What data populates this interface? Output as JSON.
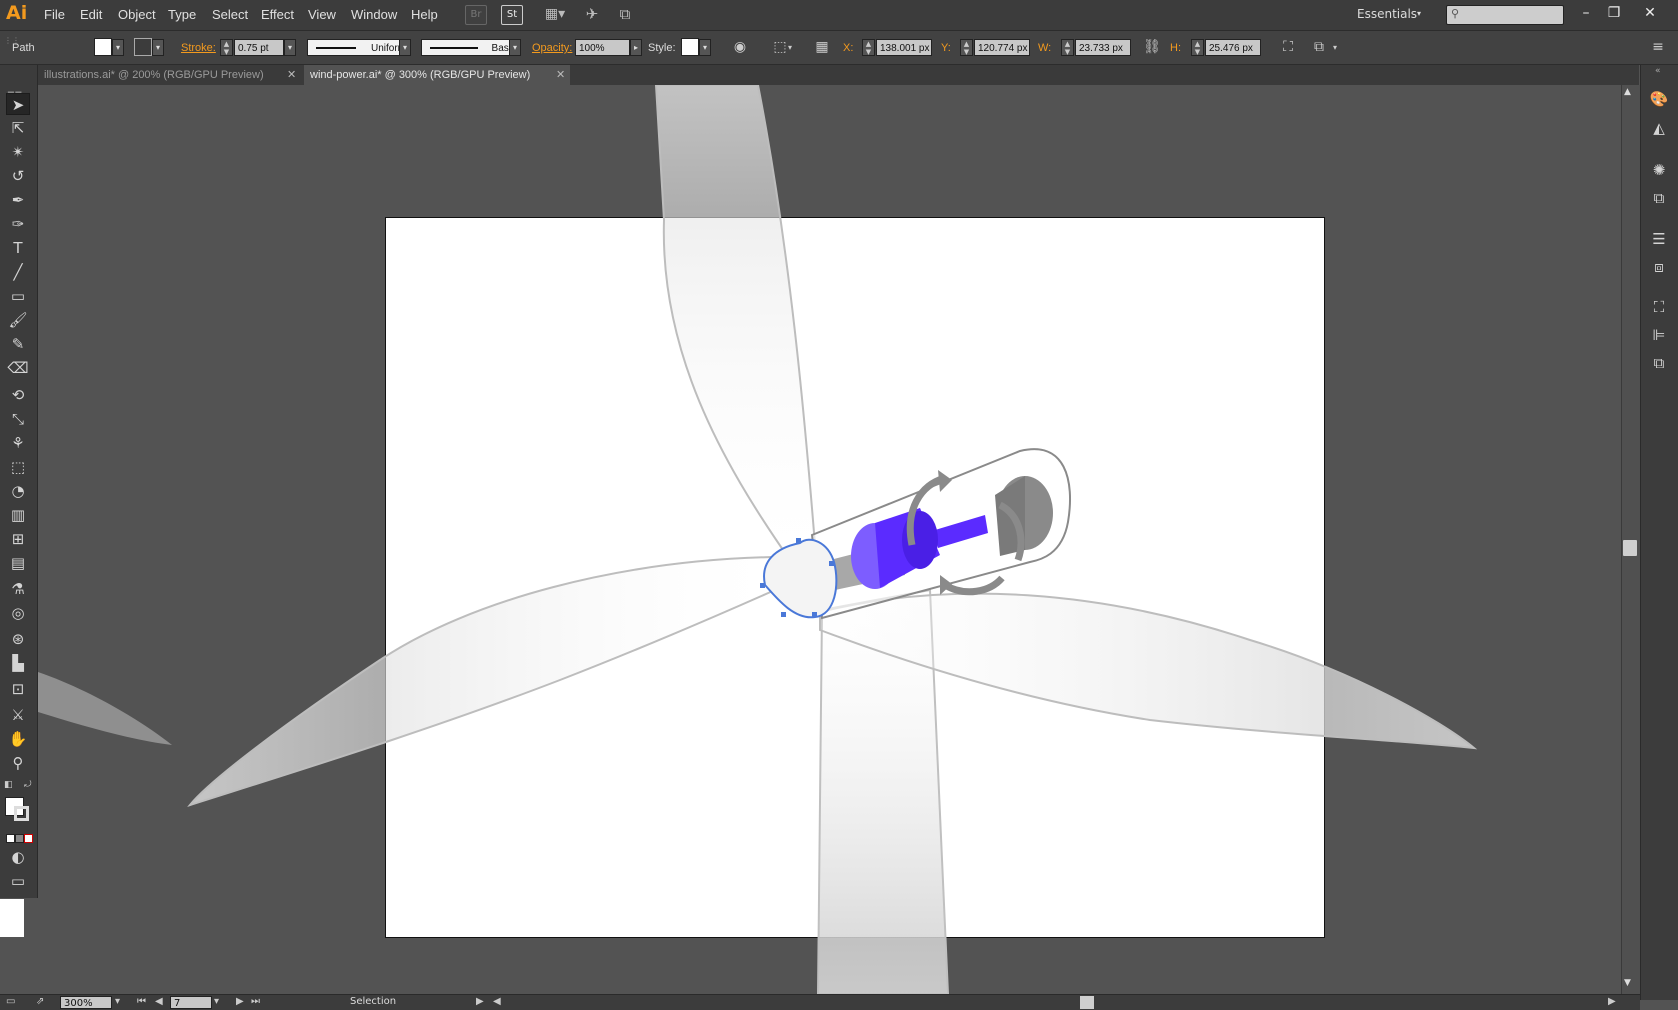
{
  "app": {
    "logo": "Ai",
    "menu": [
      "File",
      "Edit",
      "Object",
      "Type",
      "Select",
      "Effect",
      "View",
      "Window",
      "Help"
    ],
    "bridge_button": "Br",
    "stock_button": "St",
    "workspace": "Essentials",
    "search_placeholder": "",
    "accent_color": "#f39a1e"
  },
  "control_bar": {
    "selection_type": "Path",
    "stroke_label": "Stroke:",
    "stroke_weight": "0.75 pt",
    "stroke_profile": "Uniform",
    "brush": "Basic",
    "opacity_label": "Opacity:",
    "opacity": "100%",
    "style_label": "Style:",
    "x_label": "X:",
    "x": "138.001 px",
    "y_label": "Y:",
    "y": "120.774 px",
    "w_label": "W:",
    "w": "23.733 px",
    "h_label": "H:",
    "h": "25.476 px"
  },
  "tabs": [
    {
      "label": "illustrations.ai* @ 200% (RGB/GPU Preview)",
      "active": false
    },
    {
      "label": "wind-power.ai* @ 300% (RGB/GPU Preview)",
      "active": true
    }
  ],
  "tools": [
    "selection-tool",
    "direct-selection-tool",
    "magic-wand-tool",
    "lasso-tool",
    "pen-tool",
    "curvature-tool",
    "type-tool",
    "line-tool",
    "rectangle-tool",
    "paintbrush-tool",
    "pencil-tool",
    "eraser-tool",
    "rotate-tool",
    "scale-tool",
    "width-tool",
    "free-transform-tool",
    "shape-builder-tool",
    "perspective-grid-tool",
    "mesh-tool",
    "gradient-tool",
    "eyedropper-tool",
    "blend-tool",
    "symbol-sprayer-tool",
    "column-graph-tool",
    "artboard-tool",
    "slice-tool",
    "hand-tool",
    "zoom-tool"
  ],
  "status_bar": {
    "zoom": "300%",
    "artboard_number": "7",
    "mode": "Selection"
  },
  "artwork": {
    "nacelle_color": "#5b2bff",
    "selection_color": "#4a78d8"
  }
}
